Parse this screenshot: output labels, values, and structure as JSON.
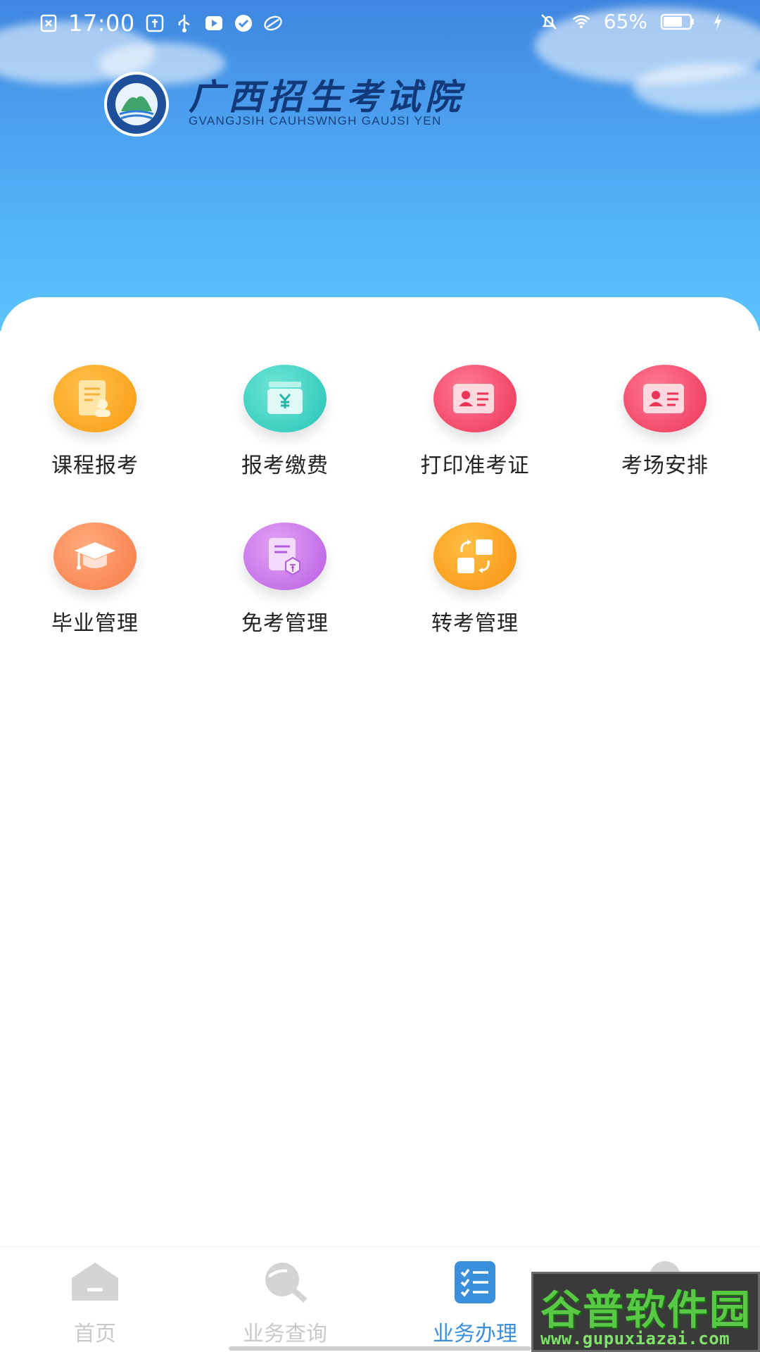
{
  "status_bar": {
    "time": "17:00",
    "battery_percent": "65%",
    "left_icons": [
      "close-box-icon",
      "usb-settings-icon",
      "usb-icon",
      "play-icon",
      "check-icon",
      "cloud-icon"
    ],
    "right_icons": [
      "bell-off-icon",
      "wifi-icon",
      "battery-icon",
      "charging-icon"
    ]
  },
  "header": {
    "title": "广西招生考试院",
    "subtitle": "GVANGJSIH CAUHSWNGH GAUJSI YEN"
  },
  "services": [
    {
      "label": "课程报考",
      "icon": "certificate-person-icon",
      "color": "#f9a51e"
    },
    {
      "label": "报考缴费",
      "icon": "wallet-yen-icon",
      "color": "#35d1c2"
    },
    {
      "label": "打印准考证",
      "icon": "id-card-icon",
      "color": "#f0456a"
    },
    {
      "label": "考场安排",
      "icon": "id-card-icon",
      "color": "#f0456a"
    },
    {
      "label": "毕业管理",
      "icon": "graduation-cap-icon",
      "color": "#fb8a5e"
    },
    {
      "label": "免考管理",
      "icon": "exempt-document-icon",
      "color": "#c778e6"
    },
    {
      "label": "转考管理",
      "icon": "transfer-squares-icon",
      "color": "#f99a1e"
    }
  ],
  "bottom_nav": {
    "items": [
      {
        "label": "首页",
        "icon": "home-icon",
        "active": false
      },
      {
        "label": "业务查询",
        "icon": "search-icon",
        "active": false
      },
      {
        "label": "业务办理",
        "icon": "checklist-icon",
        "active": true
      },
      {
        "label": "",
        "icon": "user-icon",
        "active": false
      }
    ],
    "active_color": "#3a8fdc",
    "inactive_color": "#c9c9c9"
  },
  "watermark": {
    "title": "谷普软件园",
    "url": "www.gupuxiazai.com"
  }
}
